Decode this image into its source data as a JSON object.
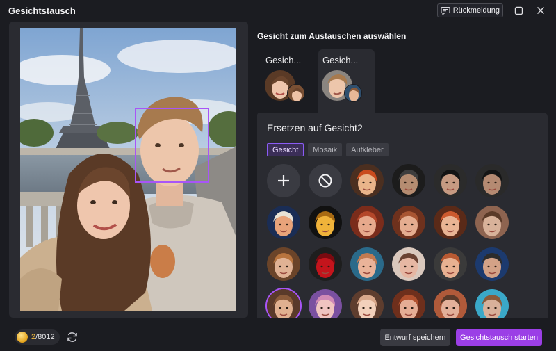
{
  "window": {
    "title": "Gesichtstausch",
    "feedback_label": "Rückmeldung",
    "feedback_icon": "chat-bubble-icon",
    "maximize_icon": "square-icon",
    "close_icon": "close-icon"
  },
  "preview": {
    "photo_description_icon": "photo",
    "accent": "#a855f7"
  },
  "face_select": {
    "title": "Gesicht zum Austauschen auswählen",
    "tabs": [
      {
        "label": "Gesich...",
        "selected": false
      },
      {
        "label": "Gesich...",
        "selected": true
      }
    ]
  },
  "replace": {
    "title": "Ersetzen auf Gesicht2",
    "categories": [
      {
        "label": "Gesicht",
        "active": true
      },
      {
        "label": "Mosaik",
        "active": false
      },
      {
        "label": "Aufkleber",
        "active": false
      }
    ],
    "grid": [
      {
        "kind": "add",
        "icon": "plus-icon"
      },
      {
        "kind": "none",
        "icon": "prohibit-icon"
      },
      {
        "kind": "face",
        "palette": [
          "#e9b48a",
          "#c94b1d",
          "#4b2f20"
        ]
      },
      {
        "kind": "face",
        "palette": [
          "#b58c71",
          "#3e3e3e",
          "#1c1c1c"
        ]
      },
      {
        "kind": "face",
        "palette": [
          "#c69a82",
          "#141414",
          "#2b2b2b"
        ]
      },
      {
        "kind": "face",
        "palette": [
          "#b58a72",
          "#151515",
          "#2a2a2a"
        ]
      },
      {
        "kind": "face",
        "palette": [
          "#e8a37a",
          "#e8e2d6",
          "#1a2d55"
        ]
      },
      {
        "kind": "face",
        "palette": [
          "#f0b33a",
          "#a86a12",
          "#111111"
        ]
      },
      {
        "kind": "face",
        "palette": [
          "#e7a98c",
          "#b4472a",
          "#7a2c1b"
        ]
      },
      {
        "kind": "face",
        "palette": [
          "#e5ad90",
          "#a85532",
          "#6e311d"
        ]
      },
      {
        "kind": "face",
        "palette": [
          "#e9b494",
          "#cc5a2e",
          "#5a2a18"
        ]
      },
      {
        "kind": "face",
        "palette": [
          "#d8b29a",
          "#5a3a28",
          "#8e6450"
        ]
      },
      {
        "kind": "face",
        "palette": [
          "#e0b294",
          "#b8743e",
          "#6b4429"
        ]
      },
      {
        "kind": "face",
        "palette": [
          "#c4141c",
          "#7a0a10",
          "#1e1e1e"
        ]
      },
      {
        "kind": "face",
        "palette": [
          "#eab399",
          "#c27a50",
          "#2a6a8a"
        ]
      },
      {
        "kind": "face",
        "palette": [
          "#e6b7a3",
          "#6a4232",
          "#d9c8bd"
        ]
      },
      {
        "kind": "face",
        "palette": [
          "#e8b191",
          "#b85a32",
          "#3a3a3a"
        ]
      },
      {
        "kind": "face",
        "palette": [
          "#d3a287",
          "#2c2c2c",
          "#1c3a6e"
        ]
      },
      {
        "kind": "face",
        "palette": [
          "#e0b090",
          "#8a5a3a",
          "#5a3a2a"
        ]
      },
      {
        "kind": "face",
        "palette": [
          "#f0c4c0",
          "#d08ab6",
          "#7a50a0"
        ]
      },
      {
        "kind": "face",
        "palette": [
          "#f2d0bb",
          "#d9a88b",
          "#5e3d2e"
        ]
      },
      {
        "kind": "face",
        "palette": [
          "#e5ad95",
          "#b0502e",
          "#6e2f1c"
        ]
      },
      {
        "kind": "face",
        "palette": [
          "#e3b09a",
          "#5a3a2a",
          "#b05a3a"
        ]
      },
      {
        "kind": "face",
        "palette": [
          "#d8b09a",
          "#8a5a3a",
          "#3aa8c8"
        ]
      }
    ]
  },
  "footer": {
    "coins_current": "2",
    "coins_total": "/8012",
    "coin_icon": "coin-icon",
    "refresh_icon": "refresh-icon",
    "save_draft_label": "Entwurf speichern",
    "start_label": "Gesichtstausch starten",
    "start_color": "#9b3fe6"
  }
}
